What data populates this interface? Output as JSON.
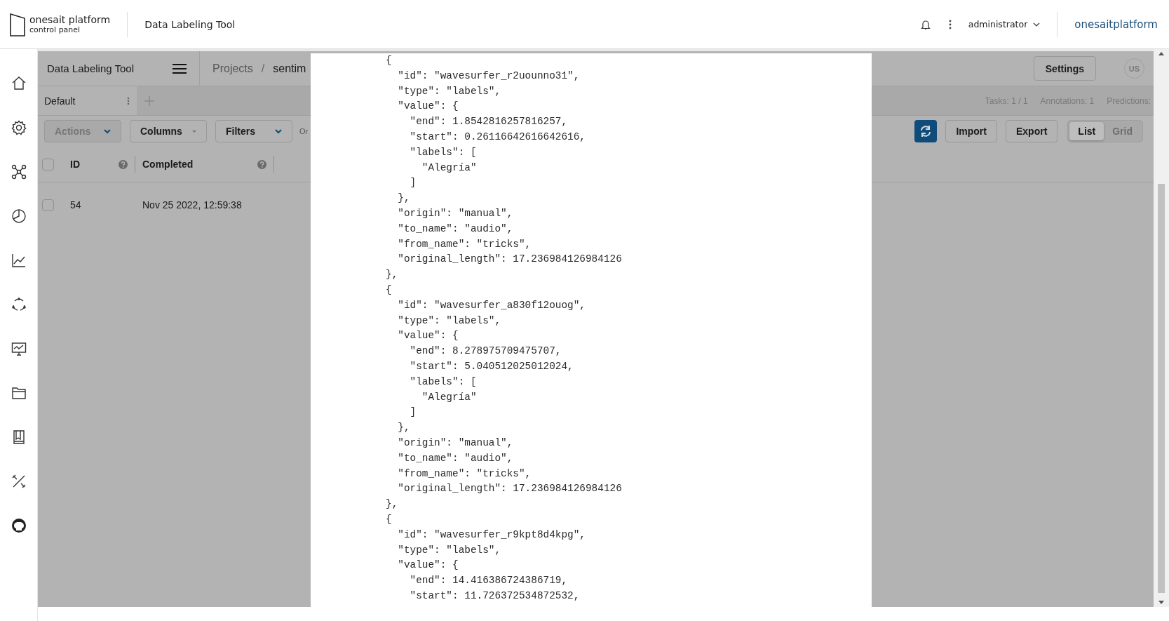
{
  "header": {
    "logo_title": "onesait platform",
    "logo_subtitle": "control panel",
    "app_title": "Data Labeling Tool",
    "user": "administrator",
    "brand": "onesaitplatform"
  },
  "app": {
    "title": "Data Labeling Tool",
    "breadcrumb": {
      "items": [
        "Projects",
        "sentim"
      ],
      "separator": "/"
    },
    "settings_button": "Settings",
    "avatar": "US"
  },
  "views": [
    {
      "label": "Default",
      "selected": true
    }
  ],
  "stats": [
    "Tasks: 1 / 1",
    "Annotations: 1",
    "Predictions:"
  ],
  "toolbar": {
    "actions": "Actions",
    "actions_disabled": true,
    "columns": "Columns",
    "filters": "Filters",
    "order": "Or",
    "import": "Import",
    "export": "Export",
    "view_modes": [
      {
        "label": "List",
        "selected": true
      },
      {
        "label": "Grid",
        "selected": false
      }
    ]
  },
  "table": {
    "all_checked": false,
    "columns": [
      "ID",
      "Completed"
    ],
    "rows": [
      {
        "checked": false,
        "cells": [
          "54",
          "Nov 25 2022, 12:59:38"
        ]
      }
    ]
  },
  "modal": {
    "code_lines": [
      "{",
      "  \"id\": \"wavesurfer_r2uounno31\",",
      "  \"type\": \"labels\",",
      "  \"value\": {",
      "    \"end\": 1.8542816257816257,",
      "    \"start\": 0.26116642616642616,",
      "    \"labels\": [",
      "      \"Alegría\"",
      "    ]",
      "  },",
      "  \"origin\": \"manual\",",
      "  \"to_name\": \"audio\",",
      "  \"from_name\": \"tricks\",",
      "  \"original_length\": 17.236984126984126",
      "},",
      "{",
      "  \"id\": \"wavesurfer_a830f12ouog\",",
      "  \"type\": \"labels\",",
      "  \"value\": {",
      "    \"end\": 8.278975709475707,",
      "    \"start\": 5.040512025012024,",
      "    \"labels\": [",
      "      \"Alegría\"",
      "    ]",
      "  },",
      "  \"origin\": \"manual\",",
      "  \"to_name\": \"audio\",",
      "  \"from_name\": \"tricks\",",
      "  \"original_length\": 17.236984126984126",
      "},",
      "{",
      "  \"id\": \"wavesurfer_r9kpt8d4kpg\",",
      "  \"type\": \"labels\",",
      "  \"value\": {",
      "    \"end\": 14.416386724386719,",
      "    \"start\": 11.726372534872532,"
    ]
  }
}
